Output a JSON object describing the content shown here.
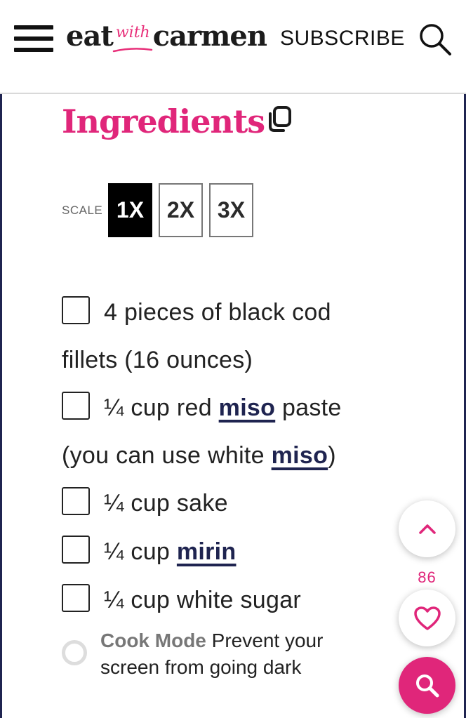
{
  "header": {
    "menu_icon": "hamburger-menu-icon",
    "logo": {
      "eat": "eat",
      "with": "with",
      "carmen": "carmen"
    },
    "subscribe_label": "SUBSCRIBE",
    "search_icon": "search-icon"
  },
  "recipe": {
    "title": "Ingredients",
    "copy_icon": "copy-icon",
    "scale": {
      "label": "SCALE",
      "options": [
        "1X",
        "2X",
        "3X"
      ],
      "selected": "1X"
    },
    "ingredients": [
      {
        "pre": "4 pieces of black cod fillets (16 ounces)",
        "link": "",
        "post": "",
        "link2": "",
        "post2": ""
      },
      {
        "pre": "¼ cup red ",
        "link": "miso",
        "post": " paste (you can use white ",
        "link2": "miso",
        "post2": ")"
      },
      {
        "pre": "¼ cup sake",
        "link": "",
        "post": "",
        "link2": "",
        "post2": ""
      },
      {
        "pre": "¼ cup ",
        "link": "mirin",
        "post": "",
        "link2": "",
        "post2": ""
      },
      {
        "pre": "¼ cup white sugar",
        "link": "",
        "post": "",
        "link2": "",
        "post2": ""
      }
    ],
    "cook_mode": {
      "label": "Cook Mode",
      "description": "Prevent your screen from going dark",
      "enabled": false
    }
  },
  "floating": {
    "scroll_top_icon": "chevron-up-icon",
    "favorite_count": "86",
    "heart_icon": "heart-icon",
    "search_icon": "search-icon"
  },
  "colors": {
    "accent": "#e0267a",
    "link": "#1f2450",
    "card_border": "#1f2450"
  }
}
